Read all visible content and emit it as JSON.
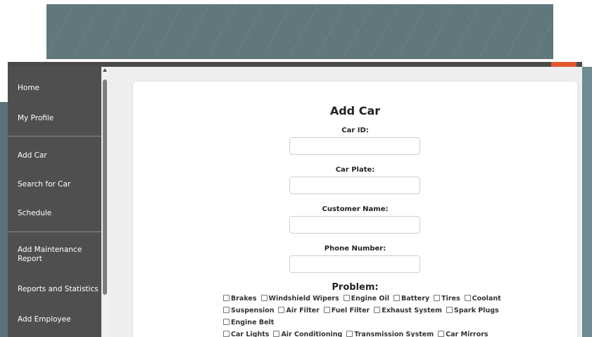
{
  "sidebar": {
    "items": [
      {
        "label": "Home"
      },
      {
        "label": "My Profile"
      },
      {
        "label": "Add Car"
      },
      {
        "label": "Search for Car"
      },
      {
        "label": "Schedule"
      },
      {
        "label": "Add Maintenance Report"
      },
      {
        "label": "Reports and Statistics"
      },
      {
        "label": "Add Employee"
      }
    ]
  },
  "form": {
    "title": "Add Car",
    "fields": [
      {
        "label": "Car ID:",
        "value": ""
      },
      {
        "label": "Car Plate:",
        "value": ""
      },
      {
        "label": "Customer Name:",
        "value": ""
      },
      {
        "label": "Phone Number:",
        "value": ""
      }
    ],
    "problem_label": "Problem:",
    "problems": [
      "Brakes",
      "Windshield Wipers",
      "Engine Oil",
      "Battery",
      "Tires",
      "Coolant",
      "Suspension",
      "Air Filter",
      "Fuel Filter",
      "Exhaust System",
      "Spark Plugs",
      "Engine Belt",
      "Car Lights",
      "Air Conditioning",
      "Transmission System",
      "Car Mirrors"
    ]
  },
  "colors": {
    "sidebar_bg": "#4f4f4f",
    "accent": "#e2552e",
    "banner": "#60777c"
  }
}
